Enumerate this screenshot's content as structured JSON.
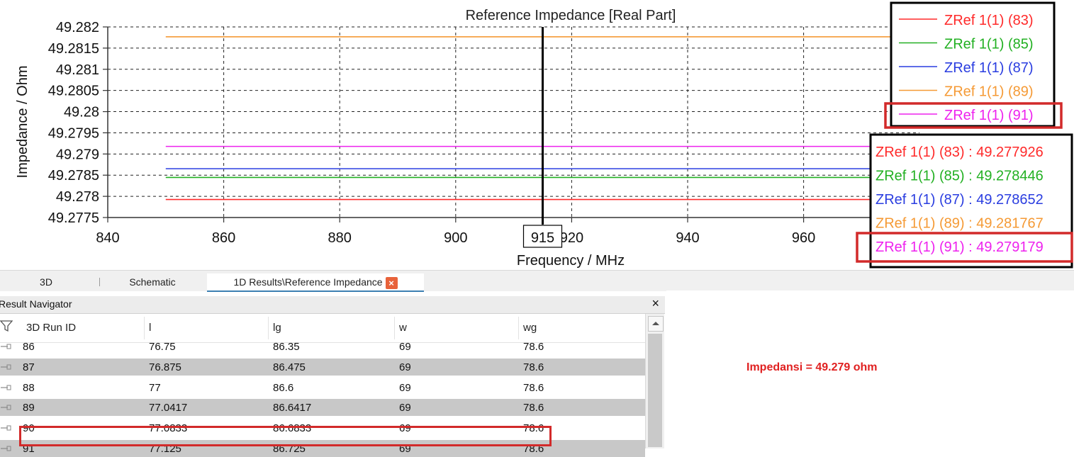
{
  "chart_data": {
    "type": "line",
    "title": "Reference Impedance [Real Part]",
    "xlabel": "Frequency / MHz",
    "ylabel": "Impedance / Ohm",
    "xlim": [
      840,
      980
    ],
    "ylim": [
      49.2775,
      49.282
    ],
    "x_ticks": [
      "840",
      "860",
      "880",
      "900",
      "920",
      "940",
      "960"
    ],
    "y_ticks": [
      "49.282",
      "49.2815",
      "49.281",
      "49.2805",
      "49.28",
      "49.2795",
      "49.279",
      "49.2785",
      "49.278",
      "49.2775"
    ],
    "grid": true,
    "marker_x": 915,
    "marker_label": "915",
    "legend_position": "top-right",
    "series": [
      {
        "name": "ZRef 1(1) (83)",
        "color": "#ff2a2a",
        "x": [
          850,
          980
        ],
        "y": [
          49.277926,
          49.277926
        ]
      },
      {
        "name": "ZRef 1(1) (85)",
        "color": "#22b022",
        "x": [
          850,
          980
        ],
        "y": [
          49.278446,
          49.278446
        ]
      },
      {
        "name": "ZRef 1(1) (87)",
        "color": "#2a3de0",
        "x": [
          850,
          980
        ],
        "y": [
          49.278652,
          49.278652
        ]
      },
      {
        "name": "ZRef 1(1) (89)",
        "color": "#f59a35",
        "x": [
          850,
          980
        ],
        "y": [
          49.281767,
          49.281767
        ]
      },
      {
        "name": "ZRef 1(1) (91)",
        "color": "#ee22ee",
        "x": [
          850,
          980
        ],
        "y": [
          49.279179,
          49.279179
        ]
      }
    ],
    "value_readouts": [
      "ZRef 1(1) (83) : 49.277926",
      "ZRef 1(1) (85) : 49.278446",
      "ZRef 1(1) (87) : 49.278652",
      "ZRef 1(1) (89) : 49.281767",
      "ZRef 1(1) (91) : 49.279179"
    ]
  },
  "tabs": [
    {
      "label": "3D"
    },
    {
      "label": "Schematic"
    },
    {
      "label": "1D Results\\Reference Impedance"
    }
  ],
  "navigator": {
    "title": "Result Navigator",
    "close_glyph": "×",
    "columns": [
      "3D Run ID",
      "l",
      "lg",
      "w",
      "wg"
    ],
    "rows": [
      [
        "86",
        "76.75",
        "86.35",
        "69",
        "78.6"
      ],
      [
        "87",
        "76.875",
        "86.475",
        "69",
        "78.6"
      ],
      [
        "88",
        "77",
        "86.6",
        "69",
        "78.6"
      ],
      [
        "89",
        "77.0417",
        "86.6417",
        "69",
        "78.6"
      ],
      [
        "90",
        "77.0833",
        "86.6833",
        "69",
        "78.6"
      ],
      [
        "91",
        "77.125",
        "86.725",
        "69",
        "78.6"
      ]
    ]
  },
  "annotation": {
    "text": "Impedansi = 49.279 ohm",
    "color": "#e02020"
  },
  "icons": {
    "filter": "filter-icon",
    "row": "row-pin-icon",
    "close_tab": "close-icon",
    "scroll_up": "chevron-up-icon"
  }
}
